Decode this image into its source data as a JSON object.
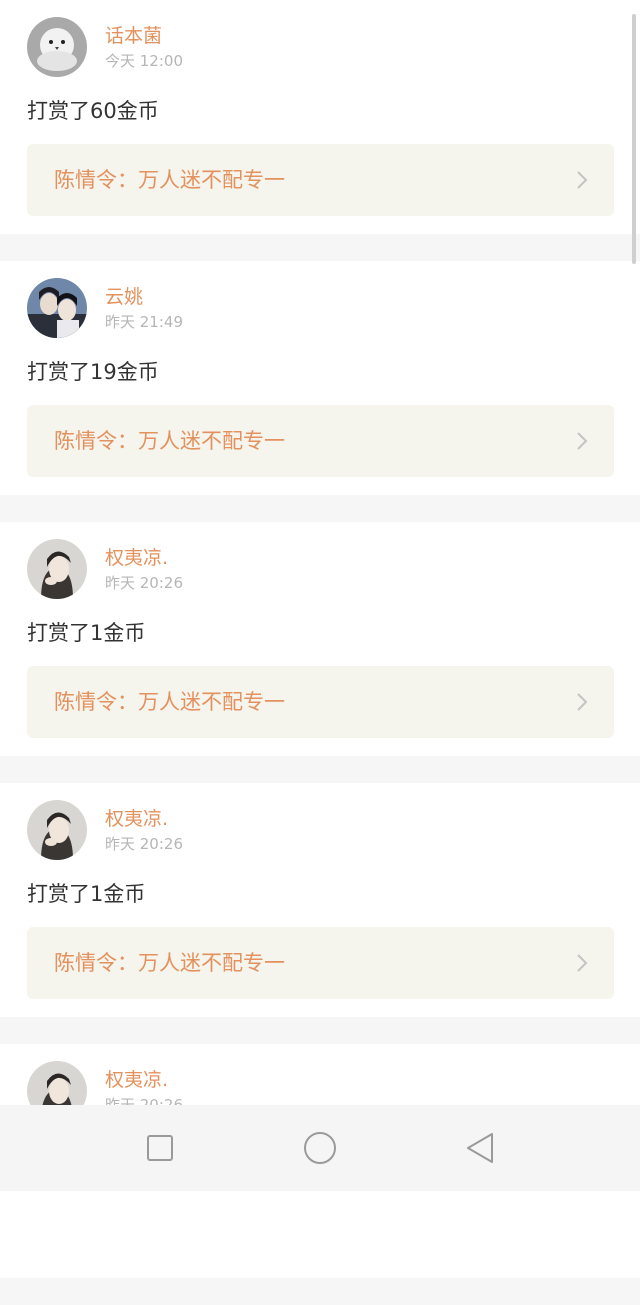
{
  "feed": [
    {
      "user": "话本菌",
      "time": "今天 12:00",
      "action": "打赏了60金币",
      "book": "陈情令：万人迷不配专一",
      "avatar_icon": "white-bird-avatar-icon"
    },
    {
      "user": "云姚",
      "time": "昨天 21:49",
      "action": "打赏了19金币",
      "book": "陈情令：万人迷不配专一",
      "avatar_icon": "anime-couple-avatar-icon"
    },
    {
      "user": "权夷凉.",
      "time": "昨天 20:26",
      "action": "打赏了1金币",
      "book": "陈情令：万人迷不配专一",
      "avatar_icon": "girl-photo-avatar-icon"
    },
    {
      "user": "权夷凉.",
      "time": "昨天 20:26",
      "action": "打赏了1金币",
      "book": "陈情令：万人迷不配专一",
      "avatar_icon": "girl-photo-avatar-icon"
    },
    {
      "user": "权夷凉.",
      "time": "昨天 20:26",
      "action": "",
      "book": "",
      "avatar_icon": "girl-photo-avatar-icon"
    }
  ],
  "navbar": {
    "recents_icon": "square-recents-icon",
    "home_icon": "circle-home-icon",
    "back_icon": "triangle-back-icon"
  },
  "colors": {
    "accent": "#e3925e",
    "text": "#333333",
    "muted": "#b6b6b6",
    "book_bg": "#f5f4ed",
    "page_bg": "#f6f6f6"
  }
}
